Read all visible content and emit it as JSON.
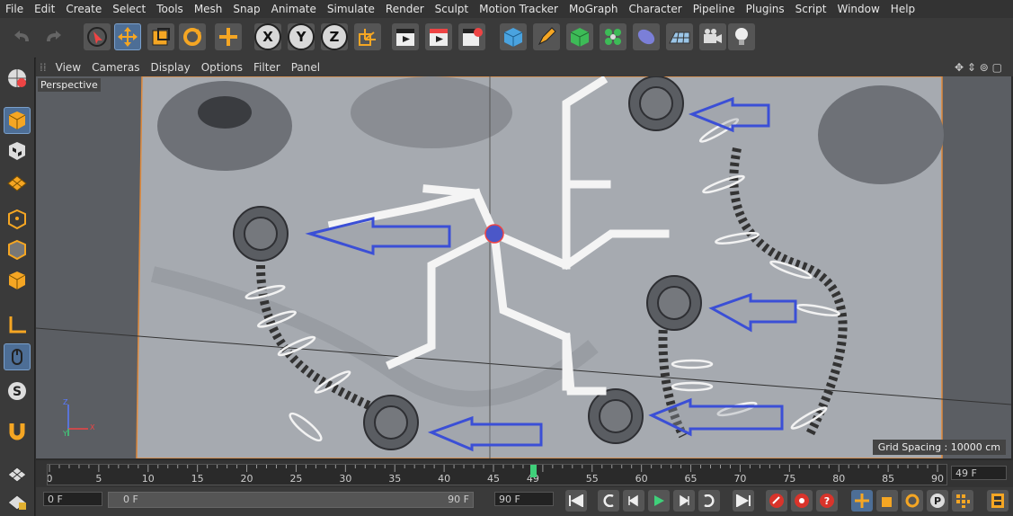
{
  "menu": [
    "File",
    "Edit",
    "Create",
    "Select",
    "Tools",
    "Mesh",
    "Snap",
    "Animate",
    "Simulate",
    "Render",
    "Sculpt",
    "Motion Tracker",
    "MoGraph",
    "Character",
    "Pipeline",
    "Plugins",
    "Script",
    "Window",
    "Help"
  ],
  "viewport_menu": [
    "View",
    "Cameras",
    "Display",
    "Options",
    "Filter",
    "Panel"
  ],
  "viewport": {
    "label": "Perspective",
    "grid_spacing": "Grid Spacing : 10000 cm",
    "axis_x": "X",
    "axis_y": "Y",
    "axis_z": "Z"
  },
  "timeline": {
    "ticks": [
      "0",
      "5",
      "10",
      "15",
      "20",
      "25",
      "30",
      "35",
      "40",
      "45",
      "49",
      "55",
      "60",
      "65",
      "70",
      "75",
      "80",
      "85",
      "90"
    ],
    "current_frame": 49,
    "end_frame_field": "49 F"
  },
  "transport": {
    "start_field": "0 F",
    "range_start": "0 F",
    "range_end": "90 F",
    "max_field": "90 F"
  },
  "colors": {
    "accent": "#4d6e96",
    "arrow": "#3b4fd6",
    "frame_border": "#e08a3c",
    "current_marker": "#3fd07a"
  },
  "icons": {
    "toolbar": [
      "undo-icon",
      "redo-icon",
      "live-selection-icon",
      "move-icon",
      "scale-icon",
      "rotate-icon",
      "last-tool-icon",
      "x-axis-icon",
      "y-axis-icon",
      "z-axis-icon",
      "world-coordinates-icon",
      "render-view-icon",
      "render-picture-viewer-icon",
      "render-settings-icon",
      "cube-icon",
      "pen-icon",
      "subdivision-icon",
      "cloner-icon",
      "deformer-icon",
      "floor-icon",
      "camera-icon",
      "light-icon"
    ],
    "left": [
      "make-editable-icon",
      "model-mode-icon",
      "texture-mode-icon",
      "workplane-icon",
      "points-mode-icon",
      "edges-mode-icon",
      "polygons-mode-icon",
      "axis-mode-icon",
      "tweak-mode-icon",
      "solo-icon",
      "snap-magnet-icon",
      "workplane-grid-icon",
      "lock-workplane-icon"
    ]
  }
}
